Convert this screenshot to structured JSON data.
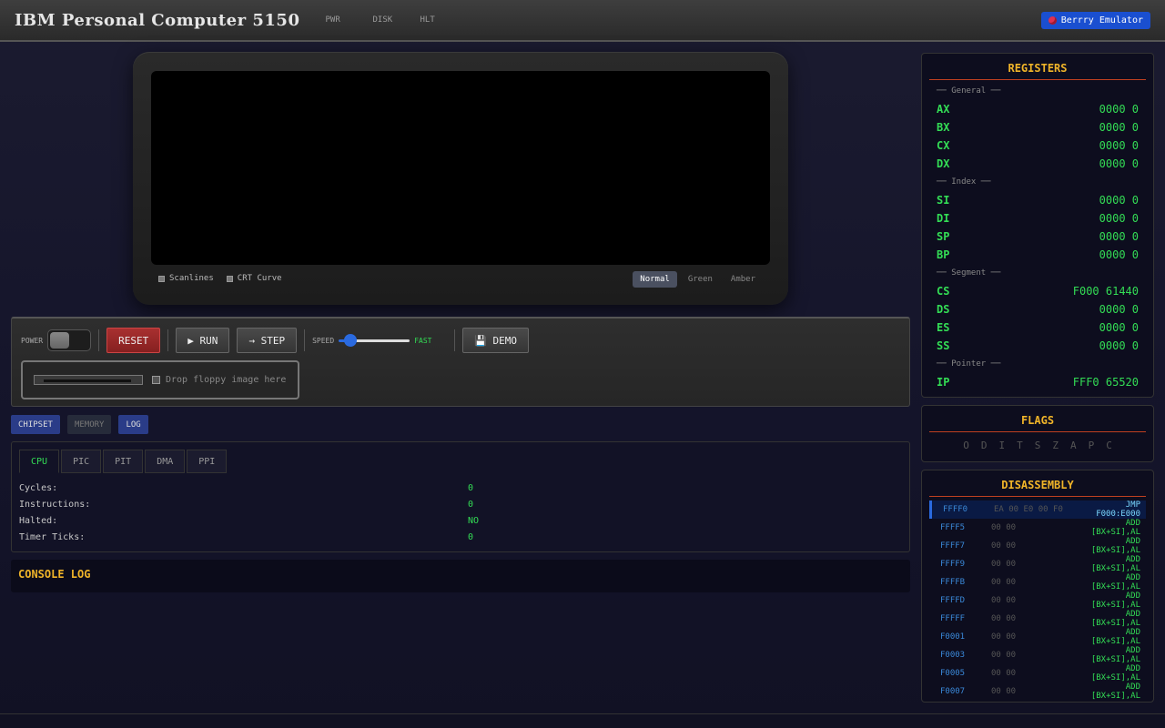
{
  "header": {
    "title": "IBM Personal Computer 5150",
    "indicators": [
      "PWR",
      "DISK",
      "HLT"
    ],
    "badge": "Berrry Emulator"
  },
  "monitor": {
    "scanlines_label": "Scanlines",
    "crt_curve_label": "CRT Curve",
    "modes": [
      "Normal",
      "Green",
      "Amber"
    ],
    "active_mode": "Normal"
  },
  "controls": {
    "power_label": "POWER",
    "reset_label": "RESET",
    "run_label": "▶ RUN",
    "step_label": "→ STEP",
    "speed_label": "SPEED",
    "speed_value_label": "FAST",
    "speed_value": 0.16,
    "demo_label": "💾 DEMO",
    "floppy_text": "Drop floppy image here"
  },
  "panel_tabs": [
    "CHIPSET",
    "MEMORY",
    "LOG"
  ],
  "chipset": {
    "tabs": [
      "CPU",
      "PIC",
      "PIT",
      "DMA",
      "PPI"
    ],
    "stats": [
      {
        "label": "Cycles:",
        "value": "0"
      },
      {
        "label": "Instructions:",
        "value": "0"
      },
      {
        "label": "Halted:",
        "value": "NO"
      },
      {
        "label": "Timer Ticks:",
        "value": "0"
      }
    ]
  },
  "console": {
    "title": "CONSOLE LOG"
  },
  "registers": {
    "title": "REGISTERS",
    "general_label": "── General ──",
    "general": [
      {
        "name": "AX",
        "value": "0000 0"
      },
      {
        "name": "BX",
        "value": "0000 0"
      },
      {
        "name": "CX",
        "value": "0000 0"
      },
      {
        "name": "DX",
        "value": "0000 0"
      }
    ],
    "index_label": "── Index ──",
    "index": [
      {
        "name": "SI",
        "value": "0000 0"
      },
      {
        "name": "DI",
        "value": "0000 0"
      },
      {
        "name": "SP",
        "value": "0000 0"
      },
      {
        "name": "BP",
        "value": "0000 0"
      }
    ],
    "segment_label": "── Segment ──",
    "segment": [
      {
        "name": "CS",
        "value": "F000 61440"
      },
      {
        "name": "DS",
        "value": "0000 0"
      },
      {
        "name": "ES",
        "value": "0000 0"
      },
      {
        "name": "SS",
        "value": "0000 0"
      }
    ],
    "pointer_label": "── Pointer ──",
    "pointer": [
      {
        "name": "IP",
        "value": "FFF0 65520"
      }
    ]
  },
  "flags": {
    "title": "FLAGS",
    "items": [
      "O",
      "D",
      "I",
      "T",
      "S",
      "Z",
      "A",
      "P",
      "C"
    ]
  },
  "disassembly": {
    "title": "DISASSEMBLY",
    "rows": [
      {
        "addr": "FFFF0",
        "bytes": "EA 00 E0 00 F0",
        "instr": "JMP F000:E000",
        "current": true
      },
      {
        "addr": "FFFF5",
        "bytes": "00 00",
        "instr": "ADD [BX+SI],AL"
      },
      {
        "addr": "FFFF7",
        "bytes": "00 00",
        "instr": "ADD [BX+SI],AL"
      },
      {
        "addr": "FFFF9",
        "bytes": "00 00",
        "instr": "ADD [BX+SI],AL"
      },
      {
        "addr": "FFFFB",
        "bytes": "00 00",
        "instr": "ADD [BX+SI],AL"
      },
      {
        "addr": "FFFFD",
        "bytes": "00 00",
        "instr": "ADD [BX+SI],AL"
      },
      {
        "addr": "FFFFF",
        "bytes": "00 00",
        "instr": "ADD [BX+SI],AL"
      },
      {
        "addr": "F0001",
        "bytes": "00 00",
        "instr": "ADD [BX+SI],AL"
      },
      {
        "addr": "F0003",
        "bytes": "00 00",
        "instr": "ADD [BX+SI],AL"
      },
      {
        "addr": "F0005",
        "bytes": "00 00",
        "instr": "ADD [BX+SI],AL"
      },
      {
        "addr": "F0007",
        "bytes": "00 00",
        "instr": "ADD [BX+SI],AL"
      }
    ]
  }
}
